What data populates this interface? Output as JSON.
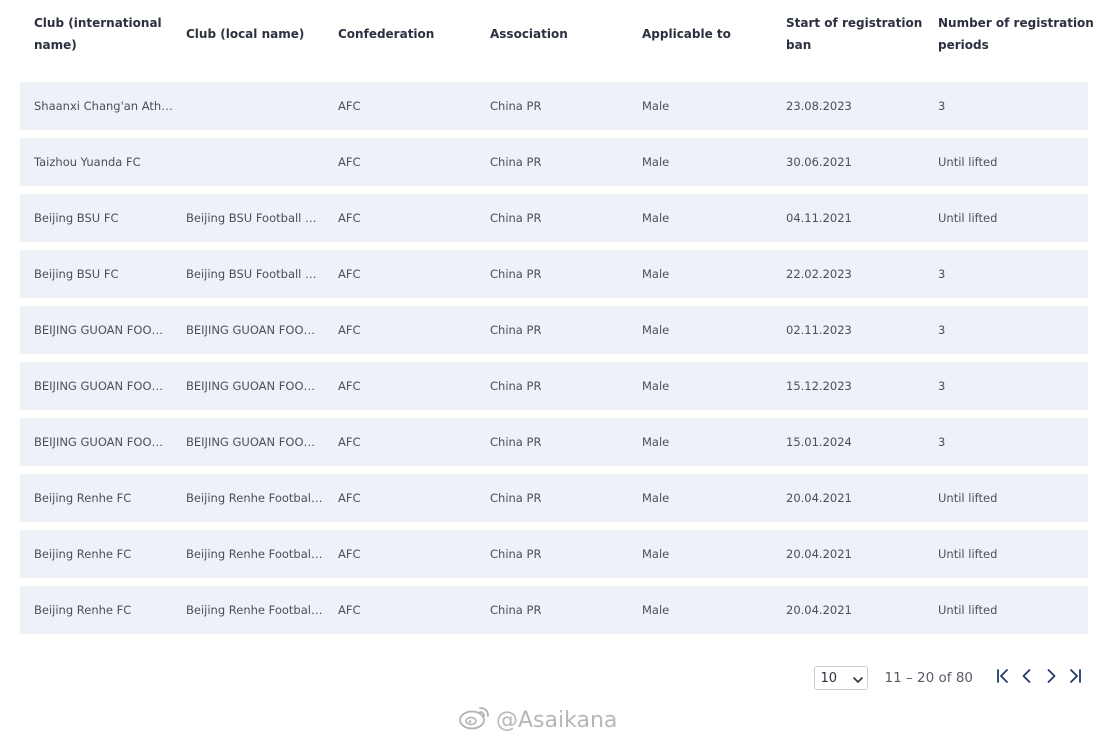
{
  "table": {
    "headers": [
      "Club (international name)",
      "Club (local name)",
      "Confederation",
      "Association",
      "Applicable to",
      "Start of registration ban",
      "Number of registration periods"
    ],
    "rows": [
      [
        "Shaanxi Chang'an Ath…",
        "",
        "AFC",
        "China PR",
        "Male",
        "23.08.2023",
        "3"
      ],
      [
        "Taizhou Yuanda FC",
        "",
        "AFC",
        "China PR",
        "Male",
        "30.06.2021",
        "Until lifted"
      ],
      [
        "Beijing BSU FC",
        "Beijing BSU Football …",
        "AFC",
        "China PR",
        "Male",
        "04.11.2021",
        "Until lifted"
      ],
      [
        "Beijing BSU FC",
        "Beijing BSU Football …",
        "AFC",
        "China PR",
        "Male",
        "22.02.2023",
        "3"
      ],
      [
        "BEIJING GUOAN FOO…",
        "BEIJING GUOAN FOO…",
        "AFC",
        "China PR",
        "Male",
        "02.11.2023",
        "3"
      ],
      [
        "BEIJING GUOAN FOO…",
        "BEIJING GUOAN FOO…",
        "AFC",
        "China PR",
        "Male",
        "15.12.2023",
        "3"
      ],
      [
        "BEIJING GUOAN FOO…",
        "BEIJING GUOAN FOO…",
        "AFC",
        "China PR",
        "Male",
        "15.01.2024",
        "3"
      ],
      [
        "Beijing Renhe FC",
        "Beijing Renhe Footbal…",
        "AFC",
        "China PR",
        "Male",
        "20.04.2021",
        "Until lifted"
      ],
      [
        "Beijing Renhe FC",
        "Beijing Renhe Footbal…",
        "AFC",
        "China PR",
        "Male",
        "20.04.2021",
        "Until lifted"
      ],
      [
        "Beijing Renhe FC",
        "Beijing Renhe Footbal…",
        "AFC",
        "China PR",
        "Male",
        "20.04.2021",
        "Until lifted"
      ]
    ]
  },
  "pagination": {
    "page_size": "10",
    "range_text": "11 – 20 of 80",
    "icons": [
      "first-page-icon",
      "previous-page-icon",
      "next-page-icon",
      "last-page-icon"
    ]
  },
  "watermark": {
    "text": "@Asaikana",
    "icon": "weibo-logo-icon"
  },
  "colors": {
    "row_background": "#eef1f7",
    "text": "#4b4f5c",
    "header_text": "#2c3140",
    "nav_icon": "#1f3a6b"
  }
}
